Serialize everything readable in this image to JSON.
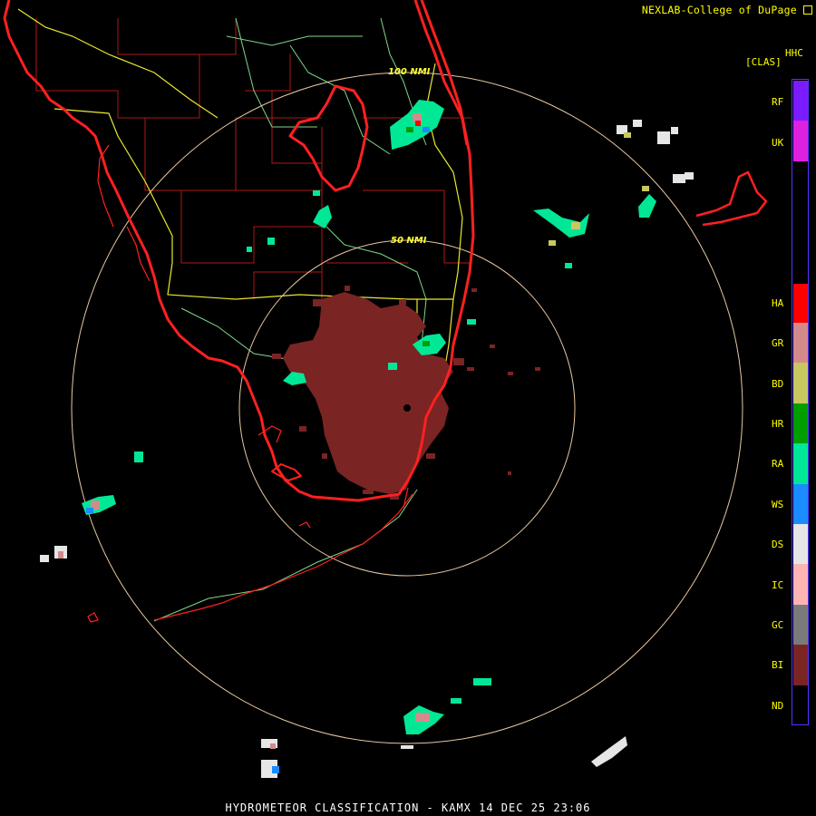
{
  "header": {
    "credit": "NEXLAB-College of DuPage"
  },
  "product": {
    "code": "HHC",
    "units": "[CLAS]"
  },
  "rings": [
    {
      "label": "100 NMI"
    },
    {
      "label": "50 NMI"
    }
  ],
  "legend": [
    {
      "code": "RF",
      "color": "#7a1cff"
    },
    {
      "code": "UK",
      "color": "#e020e0"
    },
    {
      "code": "HA",
      "color": "#ff0000"
    },
    {
      "code": "GR",
      "color": "#d48a8a"
    },
    {
      "code": "BD",
      "color": "#c8c860"
    },
    {
      "code": "HR",
      "color": "#009f00"
    },
    {
      "code": "RA",
      "color": "#00e896"
    },
    {
      "code": "WS",
      "color": "#1a8cff"
    },
    {
      "code": "DS",
      "color": "#e6e6e6"
    },
    {
      "code": "IC",
      "color": "#ffb4b4"
    },
    {
      "code": "GC",
      "color": "#7a7a7a"
    },
    {
      "code": "BI",
      "color": "#7a2424"
    },
    {
      "code": "ND",
      "color": "#000000"
    }
  ],
  "footer": "HYDROMETEOR CLASSIFICATION - KAMX 14 DEC 25 23:06",
  "map_colors": {
    "coast": "#ff2020",
    "county": "#b01818",
    "highway": "#e8e830",
    "road": "#7fd88a",
    "ring": "#e8c8a0"
  }
}
